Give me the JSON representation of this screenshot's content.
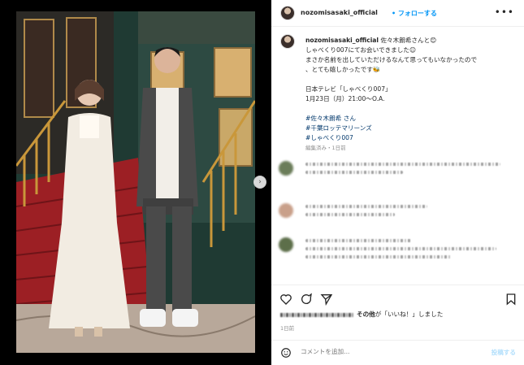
{
  "header": {
    "username": "nozomisasaki_official",
    "follow_label": "• フォローする",
    "more_label": "•••"
  },
  "caption": {
    "username": "nozomisasaki_official",
    "mention": "佐々木朗希さんと😊",
    "line1": "しゃべくり007にてお会いできました☺︎",
    "line2": "まさか名前を出していただけるなんて思ってもいなかったので",
    "line3": "、とても嬉しかったです🐝",
    "line4": "日本テレビ「しゃべくり007」",
    "line5": "1月23日（月）21:00〜O.A.",
    "hashtag1": "#佐々木朗希 さん",
    "hashtag2": "#千葉ロッテマリーンズ",
    "hashtag3": "#しゃべくり007",
    "edited": "編集済み・1日前"
  },
  "likes": {
    "text_others": "その他",
    "text_suffix": "が「いいね！」しました"
  },
  "time_ago": "1日前",
  "comment_box": {
    "placeholder": "コメントを追加...",
    "post_label": "投稿する"
  },
  "icons": {
    "next": "chevron-right-icon",
    "like": "heart-icon",
    "comment": "comment-icon",
    "share": "share-icon",
    "save": "bookmark-icon",
    "emoji": "emoji-icon"
  },
  "colors": {
    "link": "#0095f6",
    "hashtag": "#00376b",
    "muted": "#8e8e8e"
  }
}
